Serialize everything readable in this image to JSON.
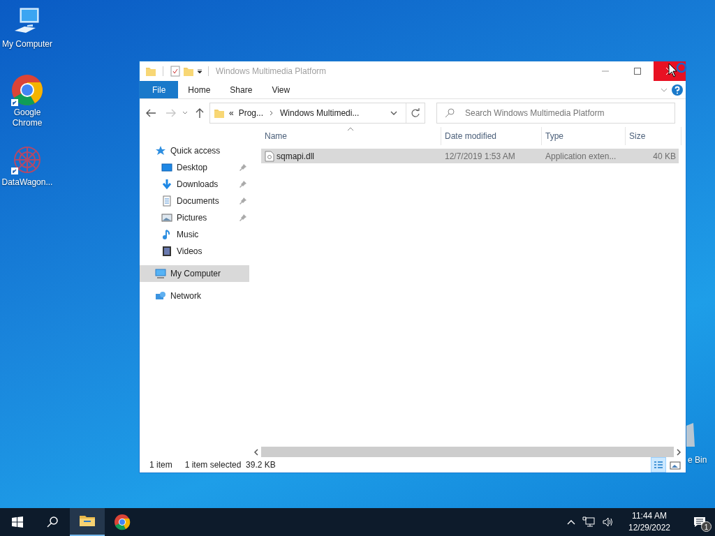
{
  "desktop_icons": [
    {
      "label": "My Computer",
      "kind": "computer"
    },
    {
      "label": "Google\nChrome",
      "kind": "chrome",
      "shortcut": true
    },
    {
      "label": "DataWagon...",
      "kind": "datawagon",
      "shortcut": true
    },
    {
      "label": "e Bin",
      "kind": "recycle"
    }
  ],
  "window": {
    "title": "Windows Multimedia Platform",
    "ribbon_tabs": [
      {
        "label": "File",
        "selected": true
      },
      {
        "label": "Home",
        "selected": false
      },
      {
        "label": "Share",
        "selected": false
      },
      {
        "label": "View",
        "selected": false
      }
    ],
    "address": {
      "overflow": "«",
      "crumbs": [
        "Prog...",
        "Windows Multimedi..."
      ]
    },
    "search": {
      "placeholder": "Search Windows Multimedia Platform"
    },
    "nav": [
      {
        "label": "Quick access",
        "kind": "star",
        "selected": false,
        "children": [
          {
            "label": "Desktop",
            "kind": "desktop",
            "pinned": true,
            "selected": false
          },
          {
            "label": "Downloads",
            "kind": "download",
            "pinned": true,
            "selected": false
          },
          {
            "label": "Documents",
            "kind": "document",
            "pinned": true,
            "selected": false
          },
          {
            "label": "Pictures",
            "kind": "pictures",
            "pinned": true,
            "selected": false
          },
          {
            "label": "Music",
            "kind": "music",
            "pinned": false,
            "selected": false
          },
          {
            "label": "Videos",
            "kind": "videos",
            "pinned": false,
            "selected": false
          }
        ]
      },
      {
        "label": "My Computer",
        "kind": "computer",
        "selected": true
      },
      {
        "label": "Network",
        "kind": "network",
        "selected": false
      }
    ],
    "columns": [
      "Name",
      "Date modified",
      "Type",
      "Size"
    ],
    "rows": [
      {
        "name": "sqmapi.dll",
        "date": "12/7/2019 1:53 AM",
        "type": "Application exten...",
        "size": "40 KB",
        "selected": true
      }
    ],
    "status": {
      "count": "1 item",
      "selection": "1 item selected  39.2 KB"
    },
    "views": [
      {
        "kind": "details",
        "selected": true
      },
      {
        "kind": "tiles",
        "selected": false
      }
    ]
  },
  "taskbar": {
    "apps": [
      {
        "kind": "explorer",
        "selected": true
      },
      {
        "kind": "chrome",
        "selected": false
      }
    ],
    "time": "11:44 AM",
    "date": "12/29/2022",
    "notifications": "1"
  }
}
